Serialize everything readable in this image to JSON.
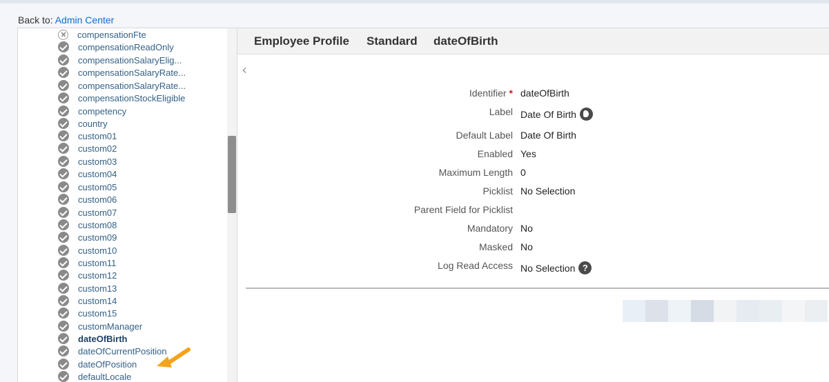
{
  "nav": {
    "back_prefix": "Back to:",
    "back_link": "Admin Center"
  },
  "field_list": [
    {
      "label": "compensationFte",
      "status": "disabled"
    },
    {
      "label": "compensationReadOnly",
      "status": "enabled"
    },
    {
      "label": "compensationSalaryElig...",
      "status": "enabled"
    },
    {
      "label": "compensationSalaryRate...",
      "status": "enabled"
    },
    {
      "label": "compensationSalaryRate...",
      "status": "enabled"
    },
    {
      "label": "compensationStockEligible",
      "status": "enabled"
    },
    {
      "label": "competency",
      "status": "enabled"
    },
    {
      "label": "country",
      "status": "enabled"
    },
    {
      "label": "custom01",
      "status": "enabled"
    },
    {
      "label": "custom02",
      "status": "enabled"
    },
    {
      "label": "custom03",
      "status": "enabled"
    },
    {
      "label": "custom04",
      "status": "enabled"
    },
    {
      "label": "custom05",
      "status": "enabled"
    },
    {
      "label": "custom06",
      "status": "enabled"
    },
    {
      "label": "custom07",
      "status": "enabled"
    },
    {
      "label": "custom08",
      "status": "enabled"
    },
    {
      "label": "custom09",
      "status": "enabled"
    },
    {
      "label": "custom10",
      "status": "enabled"
    },
    {
      "label": "custom11",
      "status": "enabled"
    },
    {
      "label": "custom12",
      "status": "enabled"
    },
    {
      "label": "custom13",
      "status": "enabled"
    },
    {
      "label": "custom14",
      "status": "enabled"
    },
    {
      "label": "custom15",
      "status": "enabled"
    },
    {
      "label": "customManager",
      "status": "enabled"
    },
    {
      "label": "dateOfBirth",
      "status": "enabled",
      "selected": true
    },
    {
      "label": "dateOfCurrentPosition",
      "status": "enabled"
    },
    {
      "label": "dateOfPosition",
      "status": "enabled"
    },
    {
      "label": "defaultLocale",
      "status": "enabled"
    }
  ],
  "breadcrumb": [
    "Employee Profile",
    "Standard",
    "dateOfBirth"
  ],
  "properties": [
    {
      "label": "Identifier",
      "value": "dateOfBirth",
      "required": true
    },
    {
      "label": "Label",
      "value": "Date Of Birth",
      "icon": "globe-icon"
    },
    {
      "label": "Default Label",
      "value": "Date Of Birth"
    },
    {
      "label": "Enabled",
      "value": "Yes"
    },
    {
      "label": "Maximum Length",
      "value": "0"
    },
    {
      "label": "Picklist",
      "value": "No Selection"
    },
    {
      "label": "Parent Field for Picklist",
      "value": ""
    },
    {
      "label": "Mandatory",
      "value": "No"
    },
    {
      "label": "Masked",
      "value": "No"
    },
    {
      "label": "Log Read Access",
      "value": "No Selection",
      "icon": "help-icon"
    }
  ],
  "colors": {
    "link": "#0a6ed1",
    "field_text": "#346187",
    "required_star": "#d1201f",
    "annotation_arrow": "#f4a41c"
  }
}
